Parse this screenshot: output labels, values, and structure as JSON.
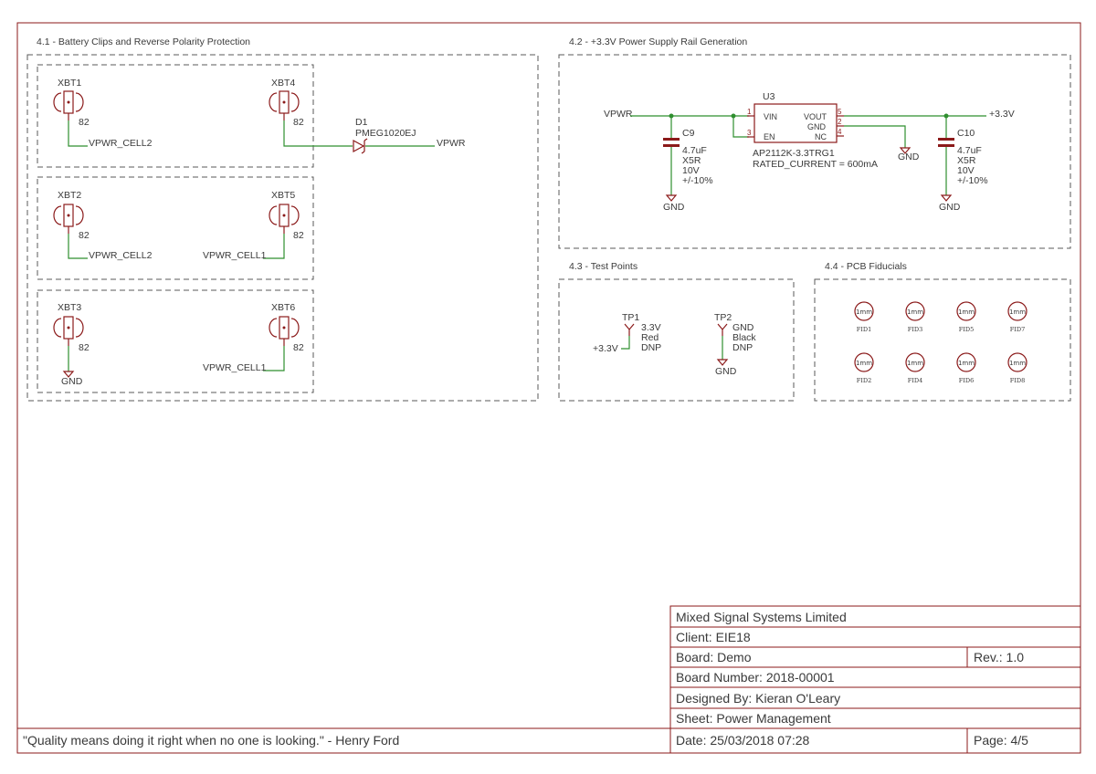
{
  "sections": {
    "battery": "4.1 - Battery Clips and Reverse Polarity Protection",
    "power": "4.2 - +3.3V Power Supply Rail Generation",
    "test": "4.3 - Test Points",
    "fiducials": "4.4 - PCB Fiducials"
  },
  "battery_clips": [
    {
      "ref": "XBT1",
      "value": "82",
      "net": "VPWR_CELL2"
    },
    {
      "ref": "XBT4",
      "value": "82"
    },
    {
      "ref": "XBT2",
      "value": "82",
      "net": "VPWR_CELL2"
    },
    {
      "ref": "XBT5",
      "value": "82",
      "net": "VPWR_CELL1"
    },
    {
      "ref": "XBT3",
      "value": "82",
      "net": "GND"
    },
    {
      "ref": "XBT6",
      "value": "82",
      "net": "VPWR_CELL1"
    }
  ],
  "diode": {
    "ref": "D1",
    "part": "PMEG1020EJ",
    "net_out": "VPWR"
  },
  "regulator": {
    "ref": "U3",
    "part": "AP2112K-3.3TRG1",
    "rating": "RATED_CURRENT = 600mA",
    "pins": {
      "vin": "VIN",
      "en": "EN",
      "vout": "VOUT",
      "gnd": "GND",
      "nc": "NC"
    },
    "pin_numbers": {
      "vin": "1",
      "en": "3",
      "vout": "5",
      "gnd": "2",
      "nc": "4"
    },
    "gnd_net": "GND"
  },
  "power_nets": {
    "input": "VPWR",
    "output": "+3.3V"
  },
  "caps": [
    {
      "ref": "C9",
      "value": "4.7uF",
      "dielectric": "X5R",
      "voltage": "10V",
      "tolerance": "+/-10%",
      "gnd": "GND"
    },
    {
      "ref": "C10",
      "value": "4.7uF",
      "dielectric": "X5R",
      "voltage": "10V",
      "tolerance": "+/-10%",
      "gnd": "GND"
    }
  ],
  "test_points": [
    {
      "ref": "TP1",
      "label": "3.3V",
      "color": "Red",
      "fit": "DNP",
      "net": "+3.3V"
    },
    {
      "ref": "TP2",
      "label": "GND",
      "color": "Black",
      "fit": "DNP",
      "net": "GND"
    }
  ],
  "fiducials": [
    {
      "ref": "FID1",
      "size": "1mm"
    },
    {
      "ref": "FID3",
      "size": "1mm"
    },
    {
      "ref": "FID5",
      "size": "1mm"
    },
    {
      "ref": "FID7",
      "size": "1mm"
    },
    {
      "ref": "FID2",
      "size": "1mm"
    },
    {
      "ref": "FID4",
      "size": "1mm"
    },
    {
      "ref": "FID6",
      "size": "1mm"
    },
    {
      "ref": "FID8",
      "size": "1mm"
    }
  ],
  "title_block": {
    "company": "Mixed Signal Systems Limited",
    "client": "Client: EIE18",
    "board": "Board: Demo",
    "rev": "Rev.:  1.0",
    "board_number": "Board Number:  2018-00001",
    "designed_by": "Designed By:     Kieran O'Leary",
    "sheet": "Sheet: Power Management",
    "date": "Date:  25/03/2018 07:28",
    "page": "Page:  4/5",
    "quote": "\"Quality means doing it right when no one is looking.\" - Henry Ford"
  },
  "colors": {
    "frame": "#8b1a1a",
    "wire": "#2f8f2f",
    "text": "#3a3a3a",
    "box": "#5a5a5a"
  }
}
